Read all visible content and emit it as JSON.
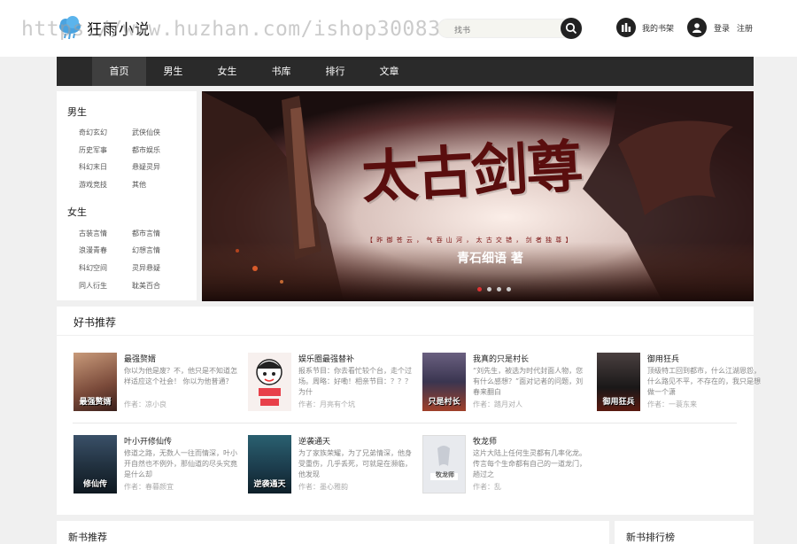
{
  "header": {
    "logo_text": "狂雨小说",
    "search_placeholder": "找书",
    "shelf_label": "我的书架",
    "login_label": "登录",
    "register_label": "注册"
  },
  "watermark": "https://www.huzhan.com/ishop30083",
  "nav": [
    "首页",
    "男生",
    "女生",
    "书库",
    "排行",
    "文章"
  ],
  "categories": {
    "male_title": "男生",
    "male": [
      "奇幻玄幻",
      "武侠仙侠",
      "历史军事",
      "都市娱乐",
      "科幻末日",
      "悬疑灵异",
      "游戏竞技",
      "其他"
    ],
    "female_title": "女生",
    "female": [
      "古装言情",
      "都市言情",
      "浪漫青春",
      "幻想言情",
      "科幻空间",
      "灵异悬疑",
      "同人衍生",
      "耽美百合"
    ]
  },
  "banner": {
    "title": "太古剑尊",
    "tagline": "【 昨 御 苍 云 ， 气 吞 山 河 ， 太 古 交 错 ， 剑 者 独 尊 】",
    "author": "青石细语 著",
    "slides": 4,
    "active_slide": 1
  },
  "recommend": {
    "title": "好书推荐",
    "books": [
      {
        "name": "最强赘婿",
        "desc": "你以为他是废？不，他只是不知道怎样适应这个社会！ 你以为他普通？",
        "author": "作者：凉小良",
        "cover_text": "最强赘婿",
        "cover_color": "#7a4a3a"
      },
      {
        "name": "娱乐圈最强替补",
        "desc": "报系节目：你去看忙较个台，走个过场。周略：好嘞！相亲节目：？？？为什",
        "author": "作者：月亮有个坑",
        "cover_text": "",
        "cover_color": "#f7f0ee"
      },
      {
        "name": "我真的只是村长",
        "desc": "“刘先生，被选为时代封面人物，您有什么感想？”面对记者的问题，刘春来翻白",
        "author": "作者：踏月对人",
        "cover_text": "只是村长",
        "cover_color": "#3a3550"
      },
      {
        "name": "御用狂兵",
        "desc": "顶级特工回到都市，什么江湖恩怨，什么路见不平，不存在的，我只是想做一个潇",
        "author": "作者：一蓑东来",
        "cover_text": "御用狂兵",
        "cover_color": "#2b2a2a"
      },
      {
        "name": "叶小开修仙传",
        "desc": "修道之路，无数人一往而情深，叶小开自然也不例外，那仙道的尽头究竟是什么却",
        "author": "作者：春暮颜宜",
        "cover_text": "修仙传",
        "cover_color": "#1e2d3a"
      },
      {
        "name": "逆袭通天",
        "desc": "为了家族荣耀，为了兄弟情深，他身受重伤，几乎丢死，可就是在濒临，他发现",
        "author": "作者：墨心雅韵",
        "cover_text": "逆袭通天",
        "cover_color": "#1b3a4a"
      },
      {
        "name": "牧龙师",
        "desc": "这片大陆上任何生灵都有几率化龙。传言每个生命都有自己的一道龙门，趟过之",
        "author": "作者：乱",
        "cover_text": "牧龙师",
        "cover_color": "#e8eaee"
      }
    ]
  },
  "new_books_title": "新书推荐",
  "new_rank_title": "新书排行榜"
}
